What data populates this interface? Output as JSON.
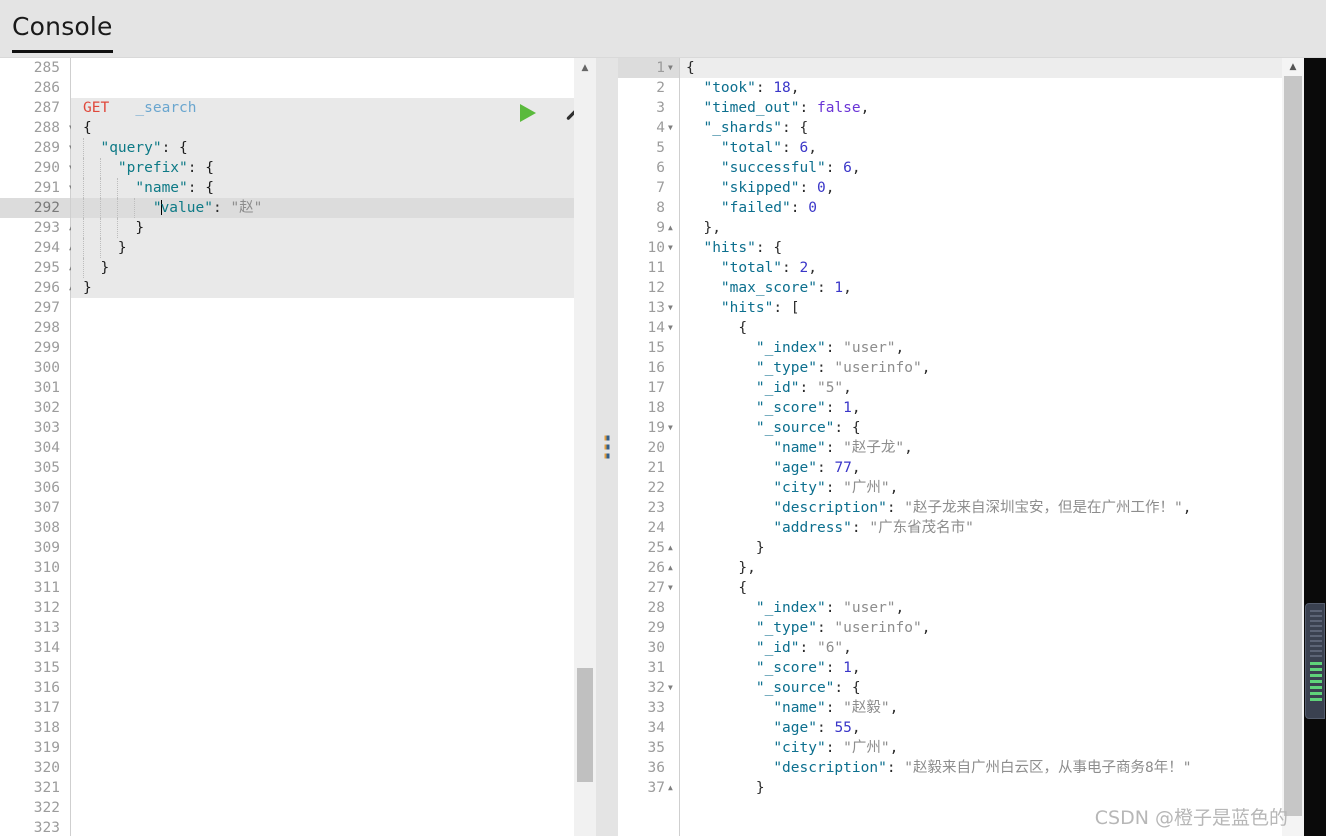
{
  "header": {
    "tab_label": "Console"
  },
  "editor": {
    "first_line_number": 285,
    "last_line_number": 323,
    "active_line_number": 292,
    "request_method": "GET",
    "request_path": "_search",
    "run_icon": "play-icon",
    "settings_icon": "wrench-icon",
    "lines": [
      {
        "n": 285,
        "fold": "",
        "text": ""
      },
      {
        "n": 286,
        "fold": "",
        "text": ""
      },
      {
        "n": 287,
        "fold": "",
        "text": "GET   _search"
      },
      {
        "n": 288,
        "fold": "down",
        "text": "{"
      },
      {
        "n": 289,
        "fold": "down",
        "text": "  \"query\": {"
      },
      {
        "n": 290,
        "fold": "down",
        "text": "    \"prefix\": {"
      },
      {
        "n": 291,
        "fold": "down",
        "text": "      \"name\": {"
      },
      {
        "n": 292,
        "fold": "",
        "text": "        \"value\": \"赵\""
      },
      {
        "n": 293,
        "fold": "up",
        "text": "      }"
      },
      {
        "n": 294,
        "fold": "up",
        "text": "    }"
      },
      {
        "n": 295,
        "fold": "up",
        "text": "  }"
      },
      {
        "n": 296,
        "fold": "up",
        "text": "}"
      },
      {
        "n": 297,
        "fold": "",
        "text": ""
      },
      {
        "n": 298,
        "fold": "",
        "text": ""
      },
      {
        "n": 299,
        "fold": "",
        "text": ""
      },
      {
        "n": 300,
        "fold": "",
        "text": ""
      },
      {
        "n": 301,
        "fold": "",
        "text": ""
      },
      {
        "n": 302,
        "fold": "",
        "text": ""
      },
      {
        "n": 303,
        "fold": "",
        "text": ""
      },
      {
        "n": 304,
        "fold": "",
        "text": ""
      },
      {
        "n": 305,
        "fold": "",
        "text": ""
      },
      {
        "n": 306,
        "fold": "",
        "text": ""
      },
      {
        "n": 307,
        "fold": "",
        "text": ""
      },
      {
        "n": 308,
        "fold": "",
        "text": ""
      },
      {
        "n": 309,
        "fold": "",
        "text": ""
      },
      {
        "n": 310,
        "fold": "",
        "text": ""
      },
      {
        "n": 311,
        "fold": "",
        "text": ""
      },
      {
        "n": 312,
        "fold": "",
        "text": ""
      },
      {
        "n": 313,
        "fold": "",
        "text": ""
      },
      {
        "n": 314,
        "fold": "",
        "text": ""
      },
      {
        "n": 315,
        "fold": "",
        "text": ""
      },
      {
        "n": 316,
        "fold": "",
        "text": ""
      },
      {
        "n": 317,
        "fold": "",
        "text": ""
      },
      {
        "n": 318,
        "fold": "",
        "text": ""
      },
      {
        "n": 319,
        "fold": "",
        "text": ""
      },
      {
        "n": 320,
        "fold": "",
        "text": ""
      },
      {
        "n": 321,
        "fold": "",
        "text": ""
      },
      {
        "n": 322,
        "fold": "",
        "text": ""
      },
      {
        "n": 323,
        "fold": "",
        "text": ""
      }
    ],
    "query_body": {
      "query": {
        "prefix": {
          "name": {
            "value": "赵"
          }
        }
      }
    }
  },
  "response": {
    "active_line_number": 1,
    "first_line_number": 1,
    "last_line_number": 37,
    "json": {
      "took": 18,
      "timed_out": false,
      "_shards": {
        "total": 6,
        "successful": 6,
        "skipped": 0,
        "failed": 0
      },
      "hits": {
        "total": 2,
        "max_score": 1,
        "hits": [
          {
            "_index": "user",
            "_type": "userinfo",
            "_id": "5",
            "_score": 1,
            "_source": {
              "name": "赵子龙",
              "age": 77,
              "city": "广州",
              "description": "赵子龙来自深圳宝安，但是在广州工作！",
              "address": "广东省茂名市"
            }
          },
          {
            "_index": "user",
            "_type": "userinfo",
            "_id": "6",
            "_score": 1,
            "_source": {
              "name": "赵毅",
              "age": 55,
              "city": "广州",
              "description": "赵毅来自广州白云区，从事电子商务8年！"
            }
          }
        ]
      }
    },
    "lines": [
      {
        "n": 1,
        "fold": "down",
        "html": "<span class=\"rp\">{</span>"
      },
      {
        "n": 2,
        "fold": "",
        "html": "  <span class=\"rk\">\"took\"</span><span class=\"rp\">: </span><span class=\"rn\">18</span><span class=\"rp\">,</span>"
      },
      {
        "n": 3,
        "fold": "",
        "html": "  <span class=\"rk\">\"timed_out\"</span><span class=\"rp\">: </span><span class=\"rb\">false</span><span class=\"rp\">,</span>"
      },
      {
        "n": 4,
        "fold": "down",
        "html": "  <span class=\"rk\">\"_shards\"</span><span class=\"rp\">: {</span>"
      },
      {
        "n": 5,
        "fold": "",
        "html": "    <span class=\"rk\">\"total\"</span><span class=\"rp\">: </span><span class=\"rn\">6</span><span class=\"rp\">,</span>"
      },
      {
        "n": 6,
        "fold": "",
        "html": "    <span class=\"rk\">\"successful\"</span><span class=\"rp\">: </span><span class=\"rn\">6</span><span class=\"rp\">,</span>"
      },
      {
        "n": 7,
        "fold": "",
        "html": "    <span class=\"rk\">\"skipped\"</span><span class=\"rp\">: </span><span class=\"rn\">0</span><span class=\"rp\">,</span>"
      },
      {
        "n": 8,
        "fold": "",
        "html": "    <span class=\"rk\">\"failed\"</span><span class=\"rp\">: </span><span class=\"rn\">0</span>"
      },
      {
        "n": 9,
        "fold": "up",
        "html": "  <span class=\"rp\">},</span>"
      },
      {
        "n": 10,
        "fold": "down",
        "html": "  <span class=\"rk\">\"hits\"</span><span class=\"rp\">: {</span>"
      },
      {
        "n": 11,
        "fold": "",
        "html": "    <span class=\"rk\">\"total\"</span><span class=\"rp\">: </span><span class=\"rn\">2</span><span class=\"rp\">,</span>"
      },
      {
        "n": 12,
        "fold": "",
        "html": "    <span class=\"rk\">\"max_score\"</span><span class=\"rp\">: </span><span class=\"rn\">1</span><span class=\"rp\">,</span>"
      },
      {
        "n": 13,
        "fold": "down",
        "html": "    <span class=\"rk\">\"hits\"</span><span class=\"rp\">: [</span>"
      },
      {
        "n": 14,
        "fold": "down",
        "html": "      <span class=\"rp\">{</span>"
      },
      {
        "n": 15,
        "fold": "",
        "html": "        <span class=\"rk\">\"_index\"</span><span class=\"rp\">: </span><span class=\"rs\">\"user\"</span><span class=\"rp\">,</span>"
      },
      {
        "n": 16,
        "fold": "",
        "html": "        <span class=\"rk\">\"_type\"</span><span class=\"rp\">: </span><span class=\"rs\">\"userinfo\"</span><span class=\"rp\">,</span>"
      },
      {
        "n": 17,
        "fold": "",
        "html": "        <span class=\"rk\">\"_id\"</span><span class=\"rp\">: </span><span class=\"rs\">\"5\"</span><span class=\"rp\">,</span>"
      },
      {
        "n": 18,
        "fold": "",
        "html": "        <span class=\"rk\">\"_score\"</span><span class=\"rp\">: </span><span class=\"rn\">1</span><span class=\"rp\">,</span>"
      },
      {
        "n": 19,
        "fold": "down",
        "html": "        <span class=\"rk\">\"_source\"</span><span class=\"rp\">: {</span>"
      },
      {
        "n": 20,
        "fold": "",
        "html": "          <span class=\"rk\">\"name\"</span><span class=\"rp\">: </span><span class=\"rs\">\"赵子龙\"</span><span class=\"rp\">,</span>"
      },
      {
        "n": 21,
        "fold": "",
        "html": "          <span class=\"rk\">\"age\"</span><span class=\"rp\">: </span><span class=\"rn\">77</span><span class=\"rp\">,</span>"
      },
      {
        "n": 22,
        "fold": "",
        "html": "          <span class=\"rk\">\"city\"</span><span class=\"rp\">: </span><span class=\"rs\">\"广州\"</span><span class=\"rp\">,</span>"
      },
      {
        "n": 23,
        "fold": "",
        "html": "          <span class=\"rk\">\"description\"</span><span class=\"rp\">: </span><span class=\"rs\">\"赵子龙来自深圳宝安，但是在广州工作！\"</span><span class=\"rp\">,</span>"
      },
      {
        "n": 24,
        "fold": "",
        "html": "          <span class=\"rk\">\"address\"</span><span class=\"rp\">: </span><span class=\"rs\">\"广东省茂名市\"</span>"
      },
      {
        "n": 25,
        "fold": "up",
        "html": "        <span class=\"rp\">}</span>"
      },
      {
        "n": 26,
        "fold": "up",
        "html": "      <span class=\"rp\">},</span>"
      },
      {
        "n": 27,
        "fold": "down",
        "html": "      <span class=\"rp\">{</span>"
      },
      {
        "n": 28,
        "fold": "",
        "html": "        <span class=\"rk\">\"_index\"</span><span class=\"rp\">: </span><span class=\"rs\">\"user\"</span><span class=\"rp\">,</span>"
      },
      {
        "n": 29,
        "fold": "",
        "html": "        <span class=\"rk\">\"_type\"</span><span class=\"rp\">: </span><span class=\"rs\">\"userinfo\"</span><span class=\"rp\">,</span>"
      },
      {
        "n": 30,
        "fold": "",
        "html": "        <span class=\"rk\">\"_id\"</span><span class=\"rp\">: </span><span class=\"rs\">\"6\"</span><span class=\"rp\">,</span>"
      },
      {
        "n": 31,
        "fold": "",
        "html": "        <span class=\"rk\">\"_score\"</span><span class=\"rp\">: </span><span class=\"rn\">1</span><span class=\"rp\">,</span>"
      },
      {
        "n": 32,
        "fold": "down",
        "html": "        <span class=\"rk\">\"_source\"</span><span class=\"rp\">: {</span>"
      },
      {
        "n": 33,
        "fold": "",
        "html": "          <span class=\"rk\">\"name\"</span><span class=\"rp\">: </span><span class=\"rs\">\"赵毅\"</span><span class=\"rp\">,</span>"
      },
      {
        "n": 34,
        "fold": "",
        "html": "          <span class=\"rk\">\"age\"</span><span class=\"rp\">: </span><span class=\"rn\">55</span><span class=\"rp\">,</span>"
      },
      {
        "n": 35,
        "fold": "",
        "html": "          <span class=\"rk\">\"city\"</span><span class=\"rp\">: </span><span class=\"rs\">\"广州\"</span><span class=\"rp\">,</span>"
      },
      {
        "n": 36,
        "fold": "",
        "html": "          <span class=\"rk\">\"description\"</span><span class=\"rp\">: </span><span class=\"rs\">\"赵毅来自广州白云区，从事电子商务8年！\"</span>"
      },
      {
        "n": 37,
        "fold": "up",
        "html": "        <span class=\"rp\">}</span>"
      }
    ]
  },
  "watermark": "CSDN @橙子是蓝色的",
  "colors": {
    "header_bg": "#e4e4e4",
    "method": "#e0493c",
    "url": "#6aa6cf",
    "key": "#0c6f8e",
    "string": "#8d8d8d",
    "number": "#3a36c8",
    "boolean": "#6a35d6",
    "run_green": "#5aba3c",
    "active_line": "#dcdcdc"
  }
}
